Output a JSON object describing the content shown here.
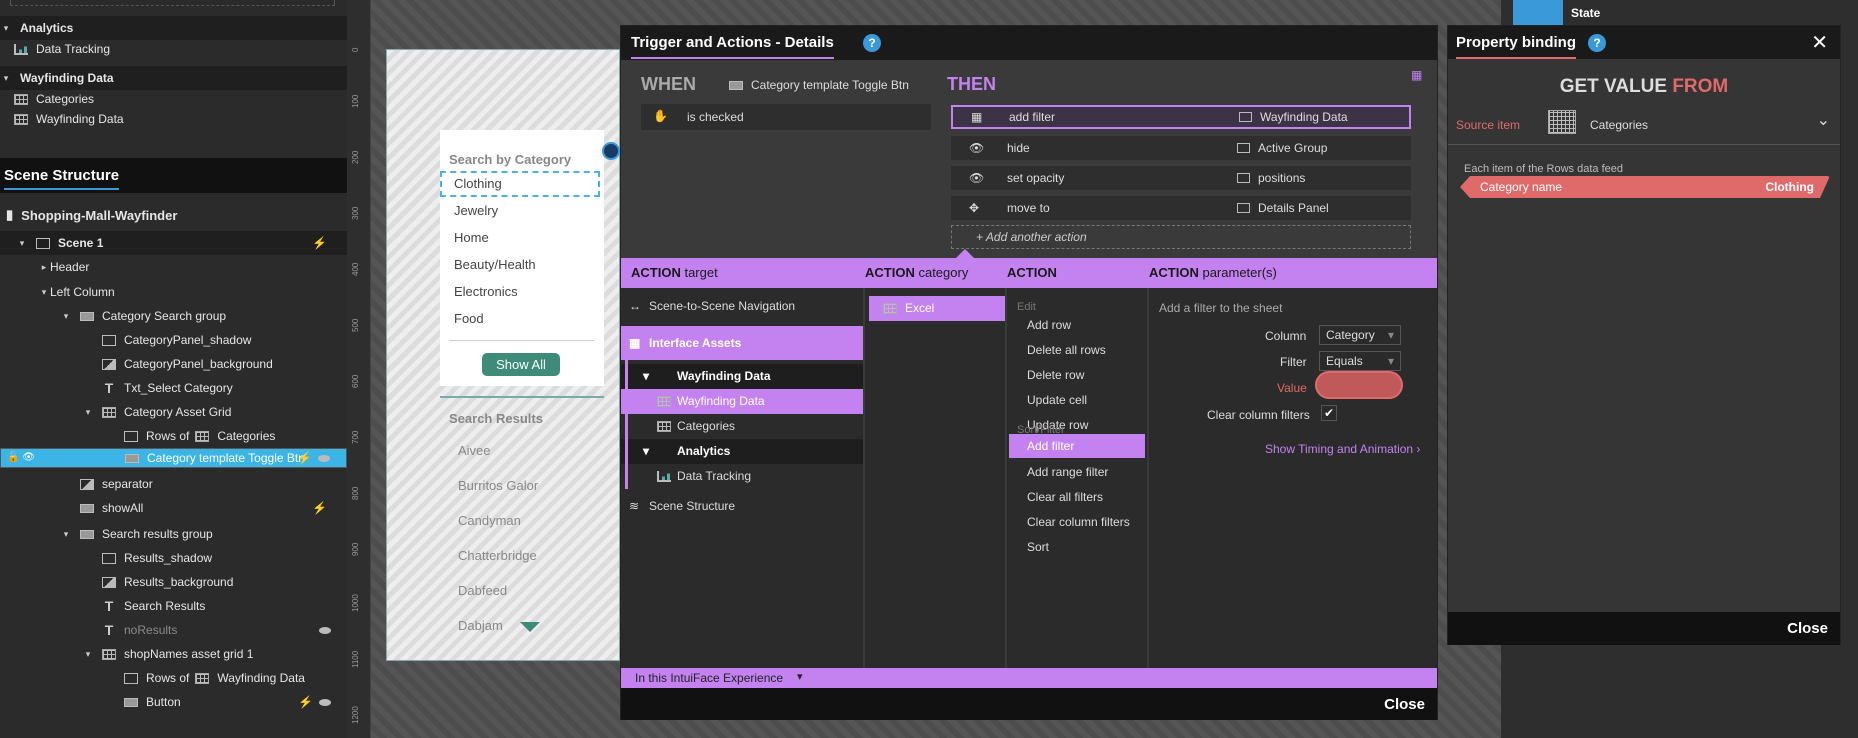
{
  "layers": {
    "analytics_header": "Analytics",
    "data_tracking": "Data Tracking",
    "wayfinding_header": "Wayfinding Data",
    "categories": "Categories",
    "wayfinding_data": "Wayfinding Data"
  },
  "scene": {
    "title": "Scene Structure",
    "project": "Shopping-Mall-Wayfinder",
    "items": [
      {
        "label": "Scene 1",
        "depth": 1
      },
      {
        "label": "Header",
        "depth": 2
      },
      {
        "label": "Left Column",
        "depth": 2
      },
      {
        "label": "Category Search group",
        "depth": 3
      },
      {
        "label": "CategoryPanel_shadow",
        "depth": 4
      },
      {
        "label": "CategoryPanel_background",
        "depth": 4
      },
      {
        "label": "Txt_Select Category",
        "depth": 4
      },
      {
        "label": "Category Asset Grid",
        "depth": 4
      },
      {
        "label": "Rows of",
        "depth": 5,
        "extra": "Categories"
      },
      {
        "label": "Category template Toggle Btn",
        "depth": 5
      },
      {
        "label": "separator",
        "depth": 3
      },
      {
        "label": "showAll",
        "depth": 3
      },
      {
        "label": "Search results group",
        "depth": 3
      },
      {
        "label": "Results_shadow",
        "depth": 4
      },
      {
        "label": "Results_background",
        "depth": 4
      },
      {
        "label": "Search Results",
        "depth": 4
      },
      {
        "label": "noResults",
        "depth": 4
      },
      {
        "label": "shopNames asset grid 1",
        "depth": 4
      },
      {
        "label": "Rows of",
        "depth": 5,
        "extra": "Wayfinding Data"
      },
      {
        "label": "Button",
        "depth": 5
      }
    ]
  },
  "ruler": [
    "0",
    "100",
    "200",
    "300",
    "400",
    "500",
    "600",
    "700",
    "800",
    "900",
    "1000",
    "1100",
    "1200"
  ],
  "canvas": {
    "search_by_category": "Search by Category",
    "categories": [
      "Clothing",
      "Jewelry",
      "Home",
      "Beauty/Health",
      "Electronics",
      "Food"
    ],
    "show_all": "Show All",
    "search_results": "Search Results",
    "results": [
      "Aivee",
      "Burritos Galor",
      "Candyman",
      "Chatterbridge",
      "Dabfeed",
      "Dabjam"
    ]
  },
  "trigger": {
    "title": "Trigger and Actions - Details",
    "help": "?",
    "when": "WHEN",
    "source": "Category template Toggle Btn",
    "condition": "is checked",
    "then": "THEN",
    "actions": [
      {
        "name": "add filter",
        "target": "Wayfinding Data"
      },
      {
        "name": "hide",
        "target": "Active Group"
      },
      {
        "name": "set opacity",
        "target": "positions"
      },
      {
        "name": "move to",
        "target": "Details Panel"
      }
    ],
    "add_action": "Add another action",
    "col_target": "target",
    "col_category": "category",
    "col_action": "ACTION",
    "col_params": "parameter(s)",
    "action_word": "ACTION",
    "targets": {
      "nav": "Scene-to-Scene Navigation",
      "interface_assets": "Interface Assets",
      "wayfinding_group": "Wayfinding Data",
      "wayfinding_data": "Wayfinding Data",
      "categories": "Categories",
      "analytics": "Analytics",
      "data_tracking": "Data Tracking",
      "scene_structure": "Scene Structure"
    },
    "category": "Excel",
    "action_groups": {
      "edit": "Edit",
      "edit_items": [
        "Add row",
        "Delete all rows",
        "Delete row",
        "Update cell",
        "Update row"
      ],
      "sort_filter": "Sort/Filter",
      "sf_items": [
        "Add filter",
        "Add range filter",
        "Clear all filters",
        "Clear column filters",
        "Sort"
      ]
    },
    "params": {
      "desc": "Add a filter to the sheet",
      "column_label": "Column",
      "column_value": "Category",
      "filter_label": "Filter",
      "filter_value": "Equals",
      "value_label": "Value",
      "clear_label": "Clear column filters",
      "timing": "Show Timing and Animation"
    },
    "footer_scope": "In this IntuiFace Experience",
    "close": "Close"
  },
  "binding": {
    "title": "Property binding",
    "help": "?",
    "get": "GET VALUE",
    "from": "FROM",
    "source_label": "Source item",
    "source_value": "Categories",
    "each_item": "Each item of the Rows data feed",
    "field": "Category name",
    "field_value": "Clothing",
    "close": "Close"
  },
  "state_label": "State"
}
